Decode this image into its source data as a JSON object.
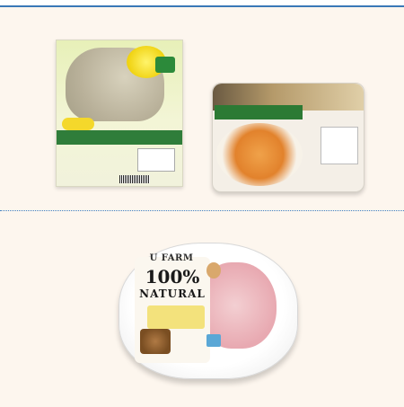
{
  "products": [
    {
      "name_slot": "product-1",
      "type": "square-pack"
    },
    {
      "name_slot": "product-2",
      "type": "tray-pack"
    },
    {
      "name_slot": "product-3",
      "type": "round-tray",
      "label": {
        "brand": "U FARM",
        "headline": "100%",
        "subline": "NATURAL"
      }
    }
  ],
  "colors": {
    "panel_background": "#fdf6ee",
    "top_border": "#3a78b7",
    "divider": "#3f7fc0"
  }
}
